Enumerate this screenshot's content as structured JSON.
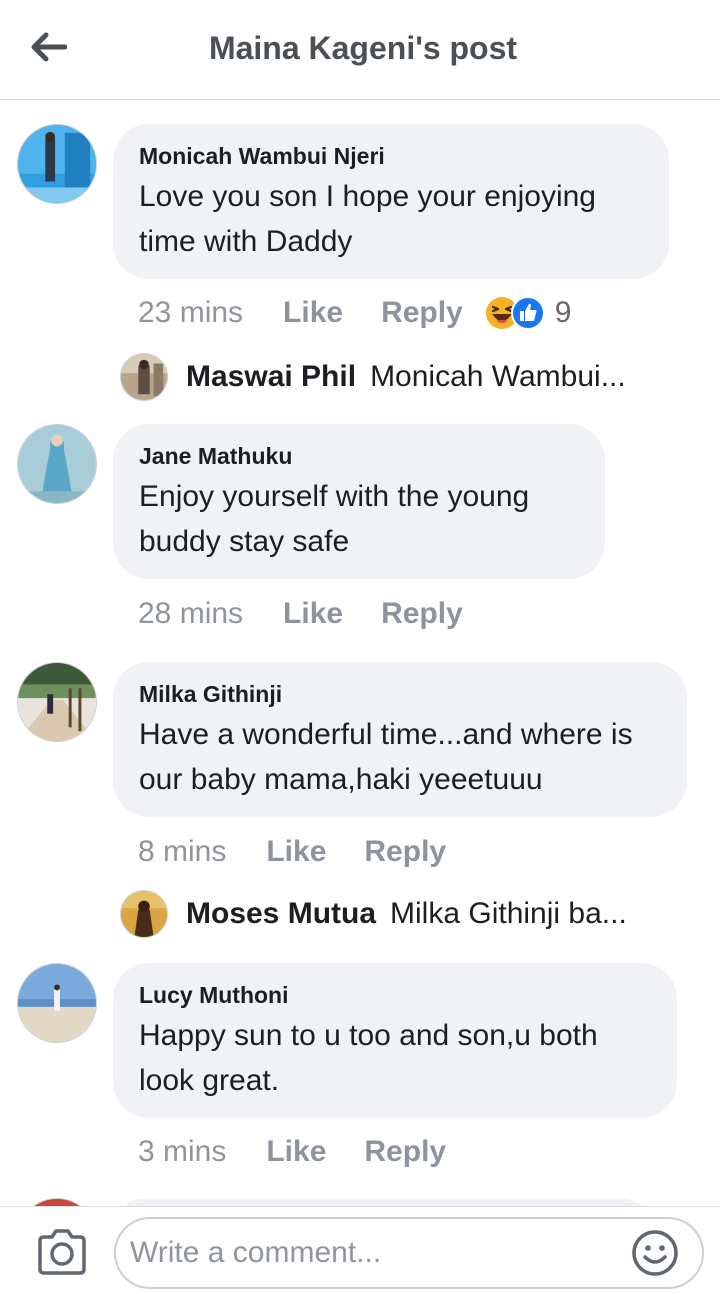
{
  "header": {
    "title": "Maina Kageni's post",
    "back_icon": "back-arrow-icon"
  },
  "comments": [
    {
      "author": "Monicah Wambui Njeri",
      "text": "Love you son I hope your enjoying time with Daddy",
      "time": "23 mins",
      "like_label": "Like",
      "reply_label": "Reply",
      "reactions": [
        "haha-icon",
        "like-icon"
      ],
      "reaction_count": "9",
      "reply": {
        "name": "Maswai Phil",
        "text": "Monicah Wambui..."
      }
    },
    {
      "author": "Jane Mathuku",
      "text": "Enjoy yourself with the young buddy stay safe",
      "time": "28 mins",
      "like_label": "Like",
      "reply_label": "Reply"
    },
    {
      "author": "Milka Githinji",
      "text": "Have a wonderful time...and where is our baby mama,haki yeeetuuu",
      "time": "8 mins",
      "like_label": "Like",
      "reply_label": "Reply",
      "reply": {
        "name": "Moses Mutua",
        "text": "Milka Githinji ba..."
      }
    },
    {
      "author": "Lucy Muthoni",
      "text": "Happy sun to u too and son,u both look great.",
      "time": "3 mins",
      "like_label": "Like",
      "reply_label": "Reply"
    }
  ],
  "composer": {
    "placeholder": "Write a comment...",
    "camera_icon": "camera-icon",
    "emoji_icon": "emoji-icon"
  },
  "colors": {
    "bubble": "#f0f2f5",
    "meta": "#90949c",
    "like_blue": "#1877f2",
    "haha_yellow": "#f7b125"
  }
}
